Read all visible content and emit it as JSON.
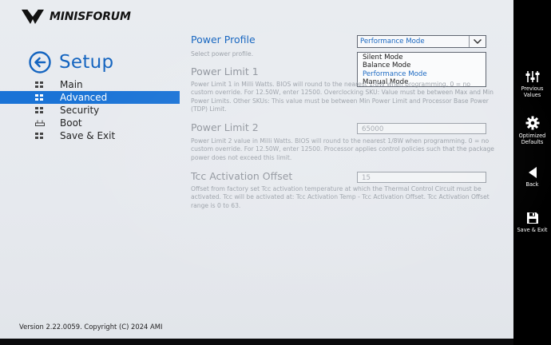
{
  "brand": {
    "logo_text": "MINISFORUM"
  },
  "sidebar": {
    "title": "Setup",
    "items": [
      {
        "label": "Main",
        "selected": false
      },
      {
        "label": "Advanced",
        "selected": true
      },
      {
        "label": "Security",
        "selected": false
      },
      {
        "label": "Boot",
        "selected": false
      },
      {
        "label": "Save & Exit",
        "selected": false
      }
    ]
  },
  "settings": {
    "power_profile": {
      "title": "Power Profile",
      "help": "Select power profile.",
      "value": "Performance Mode",
      "options": [
        "Silent Mode",
        "Balance Mode",
        "Performance Mode",
        "Manual Mode"
      ],
      "selected_option": "Performance Mode"
    },
    "power_limit_1": {
      "title": "Power Limit 1",
      "help": "Power Limit 1 in Milli Watts. BIOS will round to the nearest 1/8W when programming. 0 = no custom override. For 12.50W, enter 12500. Overclocking SKU: Value must be between Max and Min Power Limits. Other SKUs: This value must be between Min Power Limit and Processor Base Power (TDP) Limit."
    },
    "power_limit_2": {
      "title": "Power Limit 2",
      "value": "65000",
      "help": "Power Limit 2 value in Milli Watts. BIOS will round to the nearest 1/8W when programming. 0 = no custom override. For 12.50W, enter 12500. Processor applies control policies such that the package power does not exceed this limit."
    },
    "tcc_offset": {
      "title": "Tcc Activation Offset",
      "value": "15",
      "help": "Offset from factory set Tcc activation temperature at which the Thermal Control Circuit must be activated. Tcc will be activated at: Tcc Activation Temp - Tcc Activation Offset. Tcc Activation Offset range is 0 to 63."
    }
  },
  "footer": {
    "version": "Version 2.22.0059. Copyright (C) 2024 AMI"
  },
  "right_bar": {
    "buttons": [
      {
        "label": "Previous Values",
        "icon": "sliders-icon"
      },
      {
        "label": "Optimized Defaults",
        "icon": "gear-icon"
      },
      {
        "label": "Back",
        "icon": "back-triangle-icon"
      },
      {
        "label": "Save & Exit",
        "icon": "floppy-disk-icon"
      }
    ]
  },
  "colors": {
    "accent": "#1565c0",
    "selected_bg": "#1a73d6",
    "muted_text": "#9aa0a8"
  }
}
